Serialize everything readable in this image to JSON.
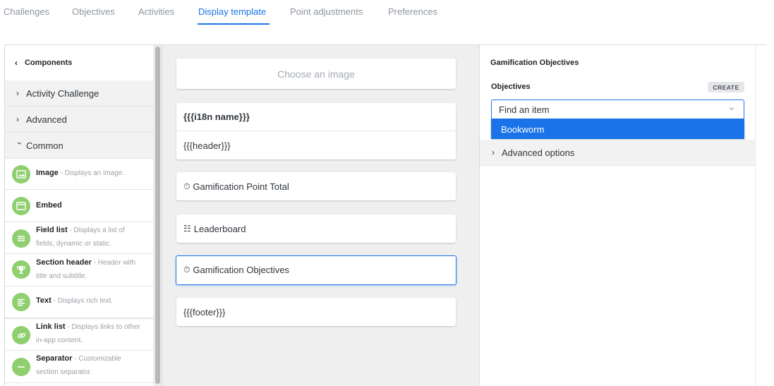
{
  "tabs": [
    {
      "label": "Challenges"
    },
    {
      "label": "Objectives"
    },
    {
      "label": "Activities"
    },
    {
      "label": "Display template",
      "active": true
    },
    {
      "label": "Point adjustments"
    },
    {
      "label": "Preferences"
    }
  ],
  "components_panel": {
    "back_glyph": "‹",
    "title": "Components",
    "groups": [
      {
        "label": "Activity Challenge",
        "expanded": false
      },
      {
        "label": "Advanced",
        "expanded": false
      },
      {
        "label": "Common",
        "expanded": true
      }
    ],
    "items": [
      {
        "name": "Image",
        "desc": " - Displays an image.",
        "icon": "image-icon"
      },
      {
        "name": "Embed",
        "desc": "",
        "icon": "embed-icon"
      },
      {
        "name": "Field list",
        "desc": " - Displays a list of fields, dynamic or static.",
        "icon": "list-icon"
      },
      {
        "name": "Section header",
        "desc": " - Header with title and subtitle.",
        "icon": "trophy-icon"
      },
      {
        "name": "Text",
        "desc": " - Displays rich text.",
        "icon": "text-icon"
      },
      {
        "name": "Link list",
        "desc": " - Displays links to other in-app content.",
        "icon": "link-icon"
      },
      {
        "name": "Separator",
        "desc": " - Customizable section separator.",
        "icon": "separator-icon"
      }
    ]
  },
  "canvas": {
    "image_placeholder": "Choose an image",
    "header_card": {
      "title": "{{{i18n name}}}",
      "subtitle": "{{{header}}}"
    },
    "blocks": [
      {
        "icon_glyph": "⏱",
        "label": "Gamification Point Total"
      },
      {
        "icon_glyph": "☷",
        "label": "Leaderboard"
      },
      {
        "icon_glyph": "⏱",
        "label": "Gamification Objectives",
        "selected": true
      }
    ],
    "footer": "{{{footer}}}"
  },
  "settings": {
    "title": "Gamification Objectives",
    "objectives_label": "Objectives",
    "create_button": "CREATE",
    "find_value": "Find an item",
    "dropdown_option": "Bookworm",
    "advanced_label": "Advanced options"
  },
  "colors": {
    "accent": "#1a73e8",
    "component_icon_bg": "#8fcf6f"
  }
}
